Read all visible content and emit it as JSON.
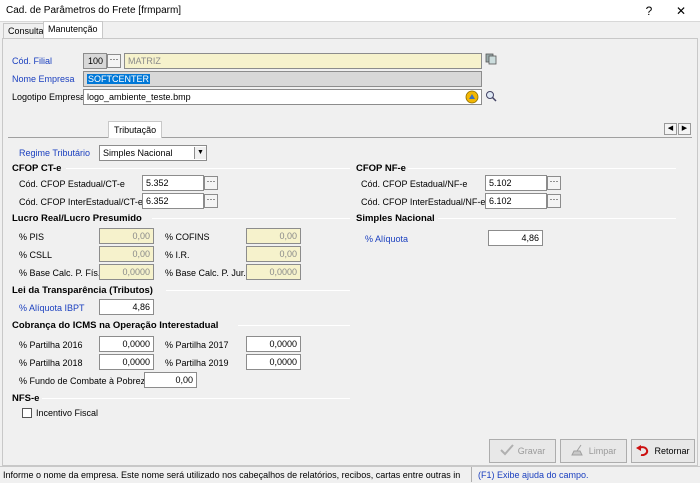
{
  "window": {
    "title": "Cad. de Parâmetros do Frete [frmparm]",
    "help_glyph": "?",
    "close_glyph": "✕"
  },
  "tabs": [
    {
      "label": "Consulta"
    },
    {
      "label": "Manutenção"
    }
  ],
  "header": {
    "cod_filial_label": "Cód. Filial",
    "cod_filial_value": "100",
    "filial_name": "MATRIZ",
    "nome_empresa_label": "Nome Empresa",
    "nome_empresa_value": "SOFTCENTER",
    "logotipo_label": "Logotipo Empresa",
    "logotipo_value": "logo_ambiente_teste.bmp"
  },
  "inner_tab": {
    "label": "Tributação"
  },
  "regime": {
    "label": "Regime Tributário",
    "value": "Simples Nacional"
  },
  "cfop_cte": {
    "title": "CFOP CT-e",
    "estadual_label": "Cód. CFOP Estadual/CT-e",
    "estadual_value": "5.352",
    "inter_label": "Cód. CFOP InterEstadual/CT-e",
    "inter_value": "6.352"
  },
  "cfop_nfe": {
    "title": "CFOP NF-e",
    "estadual_label": "Cód. CFOP Estadual/NF-e",
    "estadual_value": "5.102",
    "inter_label": "Cód. CFOP InterEstadual/NF-e",
    "inter_value": "6.102"
  },
  "lucro": {
    "title": "Lucro Real/Lucro Presumido",
    "pis_label": "% PIS",
    "pis_value": "0,00",
    "cofins_label": "% COFINS",
    "cofins_value": "0,00",
    "csll_label": "% CSLL",
    "csll_value": "0,00",
    "ir_label": "% I.R.",
    "ir_value": "0,00",
    "base_pf_label": "% Base Calc. P. Fís.",
    "base_pf_value": "0,0000",
    "base_pj_label": "% Base Calc. P. Jur.",
    "base_pj_value": "0,0000"
  },
  "simples": {
    "title": "Simples Nacional",
    "aliquota_label": "% Alíquota",
    "aliquota_value": "4,86"
  },
  "transparencia": {
    "title": "Lei da Transparência (Tributos)",
    "ibpt_label": "% Alíquota IBPT",
    "ibpt_value": "4,86"
  },
  "icms": {
    "title": "Cobrança do ICMS na Operação Interestadual",
    "p2016_label": "% Partilha 2016",
    "p2016_value": "0,0000",
    "p2017_label": "% Partilha 2017",
    "p2017_value": "0,0000",
    "p2018_label": "% Partilha 2018",
    "p2018_value": "0,0000",
    "p2019_label": "% Partilha 2019",
    "p2019_value": "0,0000",
    "fundo_label": "% Fundo de Combate à Pobreza",
    "fundo_value": "0,00"
  },
  "nfse": {
    "title": "NFS-e",
    "incentivo_label": "Incentivo Fiscal"
  },
  "buttons": {
    "gravar": "Gravar",
    "limpar": "Limpar",
    "retornar": "Retornar"
  },
  "status": {
    "message": "Informe o nome da empresa.  Este nome será utilizado nos cabeçalhos de relatórios, recibos, cartas entre outras in",
    "help": "(F1) Exibe ajuda do campo."
  }
}
